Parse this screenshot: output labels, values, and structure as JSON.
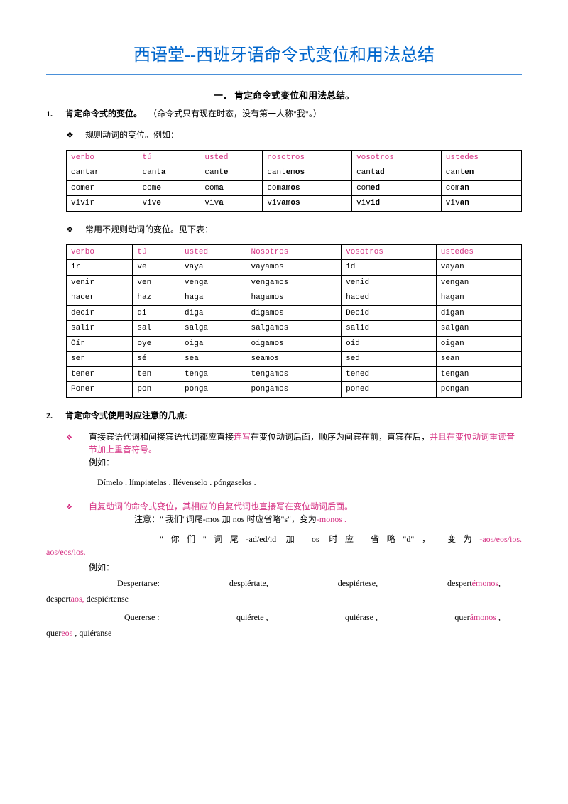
{
  "title": "西语堂--西班牙语命令式变位和用法总结",
  "sectionHeading": "一．  肯定命令式变位和用法总结。",
  "item1": {
    "num": "1.",
    "label": "肯定命令式的变位。",
    "note": "（命令式只有现在时态，没有第一人称\"我\"。）"
  },
  "regLabel": "规则动词的变位。例如：",
  "table1": {
    "headers": [
      "verbo",
      "tú",
      "usted",
      "nosotros",
      "vosotros",
      "ustedes"
    ],
    "rows": [
      [
        "cantar",
        "cant",
        "a",
        "cant",
        "e",
        "cant",
        "emos",
        "cant",
        "ad",
        "cant",
        "en"
      ],
      [
        "comer",
        "com",
        "e",
        "com",
        "a",
        "com",
        "amos",
        "com",
        "ed",
        "com",
        "an"
      ],
      [
        "vivir",
        "viv",
        "e",
        "viv",
        "a",
        "viv",
        "amos",
        "viv",
        "id",
        "viv",
        "an"
      ]
    ]
  },
  "irregLabel": "常用不规则动词的变位。见下表：",
  "table2": {
    "headers": [
      "verbo",
      "tú",
      "usted",
      "Nosotros",
      "vosotros",
      "ustedes"
    ],
    "rows": [
      [
        "ir",
        "ve",
        "vaya",
        "vayamos",
        "id",
        "vayan"
      ],
      [
        "venir",
        "ven",
        "venga",
        "vengamos",
        "venid",
        "vengan"
      ],
      [
        "hacer",
        "haz",
        "haga",
        "hagamos",
        "haced",
        "hagan"
      ],
      [
        "decir",
        "di",
        "diga",
        "digamos",
        "Decid",
        "digan"
      ],
      [
        "salir",
        "sal",
        "salga",
        "salgamos",
        "salid",
        "salgan"
      ],
      [
        "Oír",
        "oye",
        "oiga",
        "oigamos",
        "oíd",
        "oigan"
      ],
      [
        "ser",
        "sé",
        "sea",
        "seamos",
        "sed",
        "sean"
      ],
      [
        "tener",
        "ten",
        "tenga",
        "tengamos",
        "tened",
        "tengan"
      ],
      [
        "Poner",
        "pon",
        "ponga",
        "pongamos",
        "poned",
        "pongan"
      ]
    ]
  },
  "item2": {
    "num": "2.",
    "label": "肯定命令式使用时应注意的几点:"
  },
  "bullet1": {
    "pre": "直接宾语代词和间接宾语代词都应直接",
    "pink1": "连写",
    "mid": "在变位动词后面，顺序为间宾在前，直宾在后，",
    "pink2": "并且在变位动词重读音节加上重音符号。",
    "eglabel": "例如：",
    "examples": "Dímelo .        límpiatelas .            llévenselo .   póngaselos ."
  },
  "bullet2": {
    "pink1": "自复动词的命令式变位，其相应的自复代词也直接写在变位动词后面。",
    "note1a": "注意：\" 我们\"词尾-mos 加 nos 时应省略\"s\"，变为",
    "note1pink": "-monos .",
    "note2a": "\"你们\"词尾-ad/ed/id 加 os 时应  省略\"d\"，    变为",
    "note2pink": "-aos/eos/ios.",
    "eglabel": "例如：",
    "ex1": [
      "Despertarse:",
      "despiértate,",
      "despiértese,",
      "despert"
    ],
    "ex1pink": "émonos",
    "ex1tail": ",    despert",
    "ex1tailpink": "aos,",
    "ex1tail2": "   despiértense",
    "ex2": [
      "Quererse :",
      "quiérete ,",
      "quiérase ,",
      "quer"
    ],
    "ex2pink": "ámonos",
    "ex2tail": " ,   quer",
    "ex2tailpink": "eos",
    "ex2tail2": " ,     quiéranse"
  }
}
